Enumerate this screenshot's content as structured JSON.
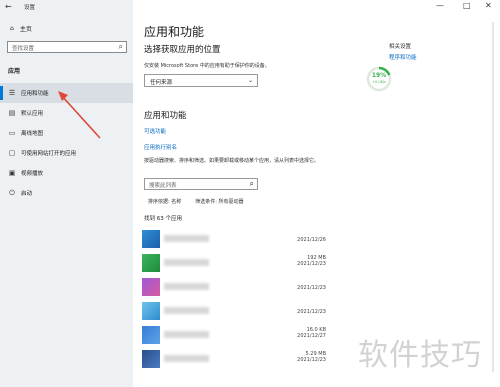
{
  "titlebar": {
    "back": "←",
    "title": "设置",
    "min": "—",
    "max": "□",
    "close": "✕"
  },
  "sidebar": {
    "home": "主页",
    "search_placeholder": "查找设置",
    "section": "应用",
    "items": [
      {
        "label": "应用和功能",
        "icon": "apps-list-icon"
      },
      {
        "label": "默认应用",
        "icon": "default-apps-icon"
      },
      {
        "label": "离线地图",
        "icon": "offline-maps-icon"
      },
      {
        "label": "可使用网站打开的应用",
        "icon": "websites-apps-icon"
      },
      {
        "label": "视频播放",
        "icon": "video-playback-icon"
      },
      {
        "label": "启动",
        "icon": "startup-icon"
      }
    ]
  },
  "main": {
    "title": "应用和功能",
    "choose_heading": "选择获取应用的位置",
    "choose_desc": "仅安装 Microsoft Store 中的应用有助于保护你的设备。",
    "source_value": "任何来源",
    "related_title": "相关设置",
    "related_link": "程序和功能",
    "ring_percent": "19%",
    "ring_sub": "+0.0K/s",
    "apps_heading": "应用和功能",
    "optional_features": "可选功能",
    "app_aliases": "应用执行别名",
    "search_desc": "按驱动器搜索、排序和筛选。如果要卸载或移动某个应用，请从列表中选择它。",
    "list_search_placeholder": "搜索此列表",
    "sort_label": "排序依据: 名称",
    "filter_label": "筛选条件: 所有驱动器",
    "found": "找到 63 个应用",
    "apps": [
      {
        "size": "",
        "date": "2021/12/26"
      },
      {
        "size": "192 MB",
        "date": "2021/12/23"
      },
      {
        "size": "",
        "date": "2021/12/23"
      },
      {
        "size": "",
        "date": "2021/12/23"
      },
      {
        "size": "16.0 KB",
        "date": "2021/12/27"
      },
      {
        "size": "5.29 MB",
        "date": "2021/12/23"
      }
    ]
  },
  "watermark": "软件技巧",
  "colors": {
    "accent": "#0078d7",
    "link": "#0067c0",
    "arrow": "#e0483a"
  }
}
